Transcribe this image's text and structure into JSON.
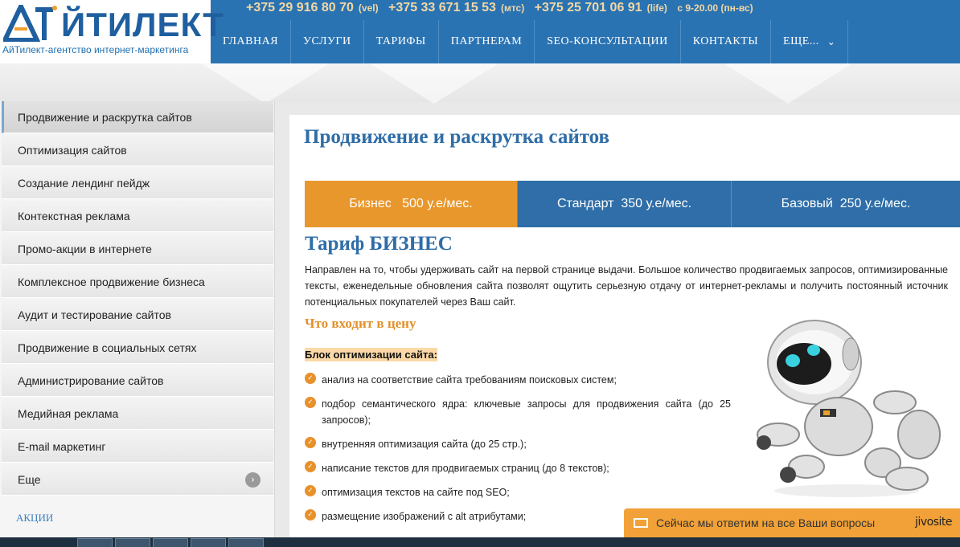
{
  "header": {
    "logo_text": "ЙТИЛЕКТ",
    "logo_tagline": "АйТилект-агентство интернет-маркетинга",
    "phones": [
      {
        "number": "+375 29 916 80 70",
        "operator": "(vel)"
      },
      {
        "number": "+375 33 671 15 53",
        "operator": "(мтс)"
      },
      {
        "number": "+375 25 701 06 91",
        "operator": "(life)"
      }
    ],
    "hours": "с 9-20.00 (пн-вс)",
    "nav": [
      {
        "label": "ГЛАВНАЯ"
      },
      {
        "label": "УСЛУГИ"
      },
      {
        "label": "ТАРИФЫ"
      },
      {
        "label": "ПАРТНЕРАМ"
      },
      {
        "label": "SEO-КОНСУЛЬТАЦИИ"
      },
      {
        "label": "КОНТАКТЫ"
      },
      {
        "label": "ЕЩЕ..."
      }
    ]
  },
  "sidebar": {
    "items": [
      {
        "label": "Продвижение и раскрутка сайтов",
        "active": true
      },
      {
        "label": "Оптимизация сайтов"
      },
      {
        "label": "Создание лендинг пейдж"
      },
      {
        "label": "Контекстная реклама"
      },
      {
        "label": "Промо-акции в интернете"
      },
      {
        "label": "Комплексное продвижение бизнеса"
      },
      {
        "label": "Аудит и тестирование сайтов"
      },
      {
        "label": "Продвижение в социальных сетях"
      },
      {
        "label": "Администрирование сайтов"
      },
      {
        "label": "Медийная реклама"
      },
      {
        "label": "E-mail маркетинг"
      },
      {
        "label": "Еще"
      }
    ],
    "actions_label": "АКЦИИ"
  },
  "main": {
    "title": "Продвижение и раскрутка сайтов",
    "tabs": [
      {
        "label": "Бизнес   500 у.е/мес.",
        "active": true
      },
      {
        "label": "Стандарт  350 у.е/мес."
      },
      {
        "label": "Базовый  250 у.е/мес."
      }
    ],
    "tariff_title": "Тариф БИЗНЕС",
    "intro": "Направлен на то, чтобы удерживать сайт на первой странице выдачи. Большое количество продвигаемых запросов, оптимизированные тексты, еженедельные обновления сайта позволят ощутить серьезную отдачу от интернет-рекламы и получить постоянный источник потенциальных покупателей через Ваш сайт.",
    "includes_title": "Что входит в цену",
    "block_title": "Блок оптимизации сайта:",
    "features": [
      "анализ на соответствие сайта требованиям поисковых систем;",
      "подбор семантического ядра: ключевые запросы для продвижения сайта (до 25 запросов);",
      "внутренняя оптимизация сайта (до 25 стр.);",
      "написание текстов для продвигаемых страниц (до 8 текстов);",
      "оптимизация текстов на сайте под SEO;",
      "размещение изображений с alt атрибутами;"
    ]
  },
  "chat": {
    "text": "Сейчас мы ответим на все Ваши вопросы",
    "brand": "jivosite"
  },
  "colors": {
    "brand_blue": "#2a73b3",
    "accent_orange": "#e8972c",
    "tab_blue": "#2f6ea8"
  }
}
